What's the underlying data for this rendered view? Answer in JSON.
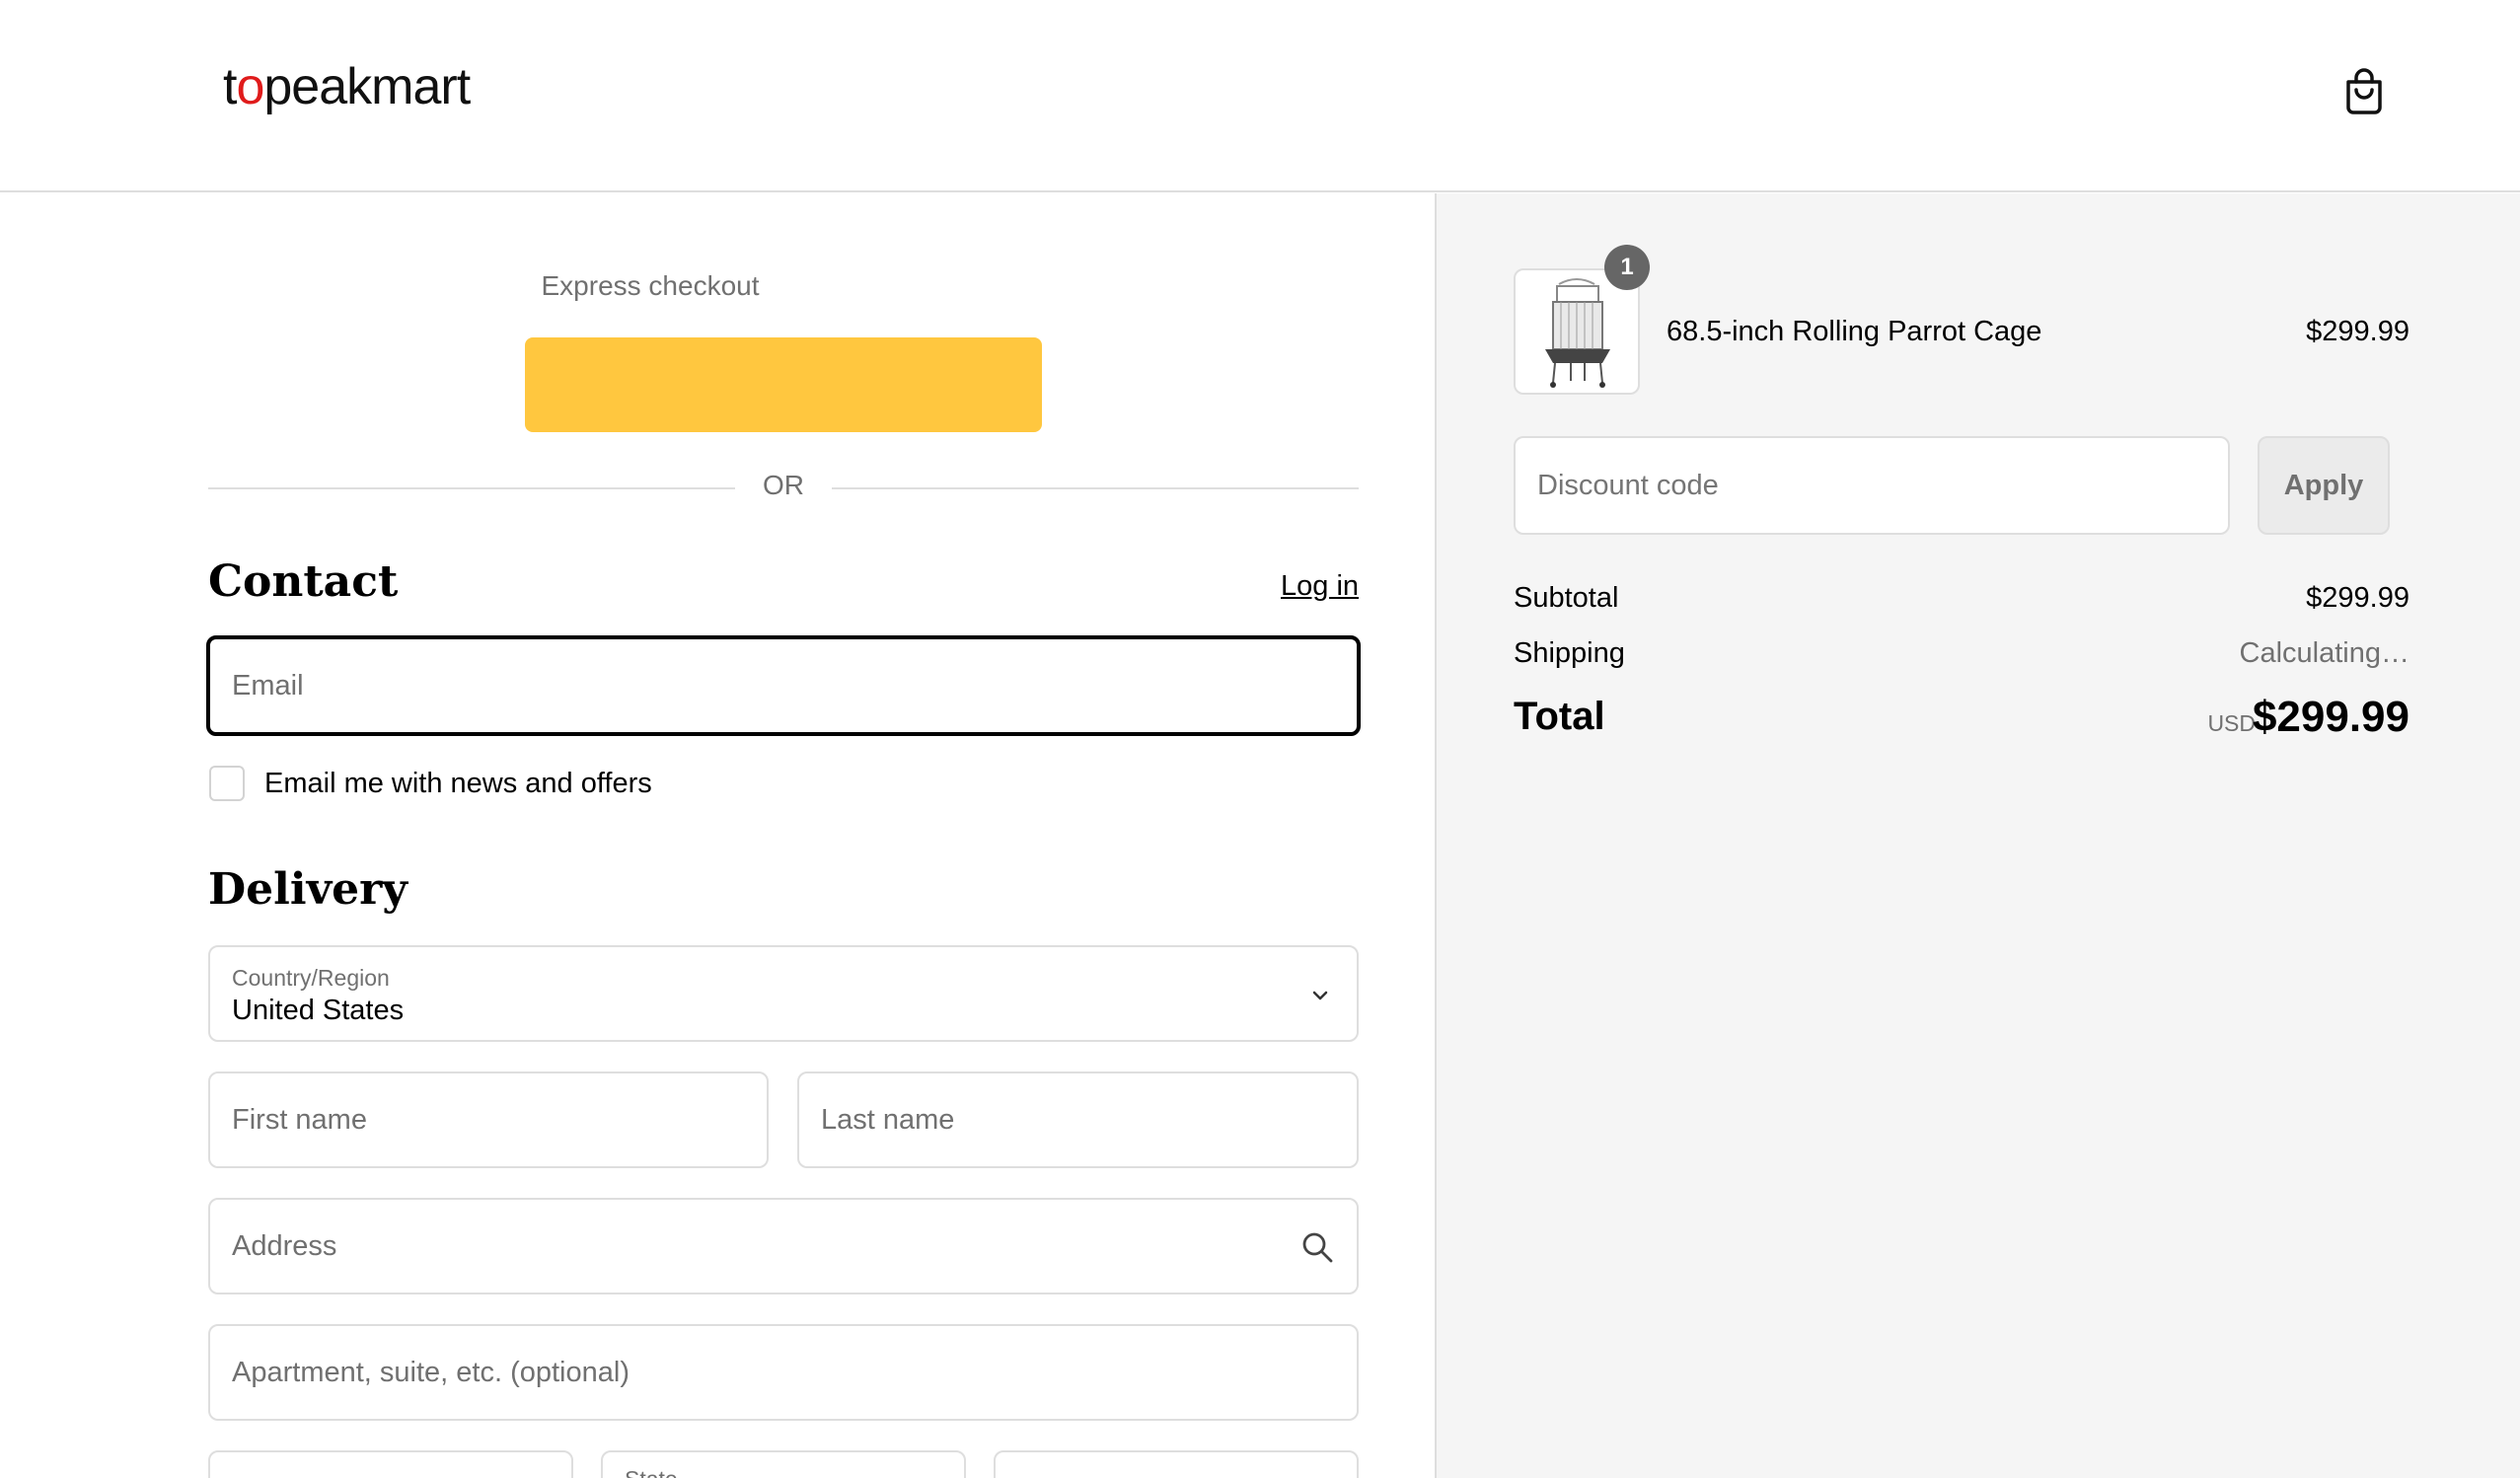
{
  "header": {
    "logo_prefix": "t",
    "logo_o": "o",
    "logo_suffix": "peakmart",
    "cart_icon": "shopping-bag-icon"
  },
  "express": {
    "title": "Express checkout",
    "button_color": "#ffc73f",
    "divider_text": "OR"
  },
  "contact": {
    "title": "Contact",
    "login_label": "Log in",
    "email_placeholder": "Email",
    "newsletter_label": "Email me with news and offers"
  },
  "delivery": {
    "title": "Delivery",
    "country_label": "Country/Region",
    "country_value": "United States",
    "first_name_placeholder": "First name",
    "last_name_placeholder": "Last name",
    "address_placeholder": "Address",
    "apartment_placeholder": "Apartment, suite, etc. (optional)",
    "state_label": "State"
  },
  "order": {
    "item": {
      "quantity": "1",
      "name": "68.5-inch Rolling Parrot Cage",
      "price": "$299.99"
    },
    "discount_placeholder": "Discount code",
    "apply_label": "Apply",
    "subtotal_label": "Subtotal",
    "subtotal_value": "$299.99",
    "shipping_label": "Shipping",
    "shipping_value": "Calculating…",
    "total_label": "Total",
    "currency": "USD",
    "total_value": "$299.99"
  },
  "colors": {
    "accent": "#ffc73f",
    "logo_red": "#e01b1b",
    "sidebar_bg": "#f5f5f5"
  }
}
